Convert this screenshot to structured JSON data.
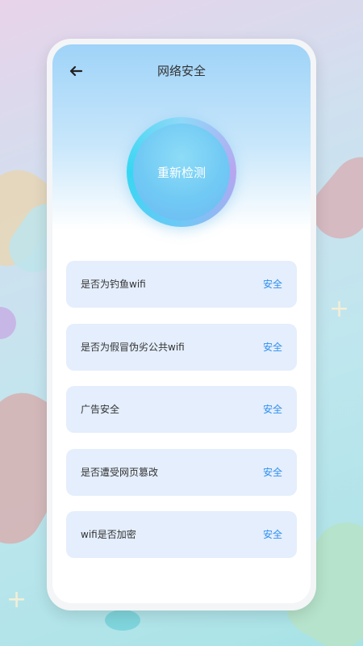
{
  "header": {
    "title": "网络安全",
    "back_icon": "arrow-left-icon"
  },
  "detect_button": {
    "label": "重新检测"
  },
  "checks": [
    {
      "label": "是否为钓鱼wifi",
      "status": "安全"
    },
    {
      "label": "是否为假冒伪劣公共wifi",
      "status": "安全"
    },
    {
      "label": "广告安全",
      "status": "安全"
    },
    {
      "label": "是否遭受网页篡改",
      "status": "安全"
    },
    {
      "label": "wifi是否加密",
      "status": "安全"
    }
  ],
  "colors": {
    "status_safe": "#2f8ff0",
    "item_background": "#e4eefc",
    "header_gradient_top": "#9fd3f8"
  }
}
